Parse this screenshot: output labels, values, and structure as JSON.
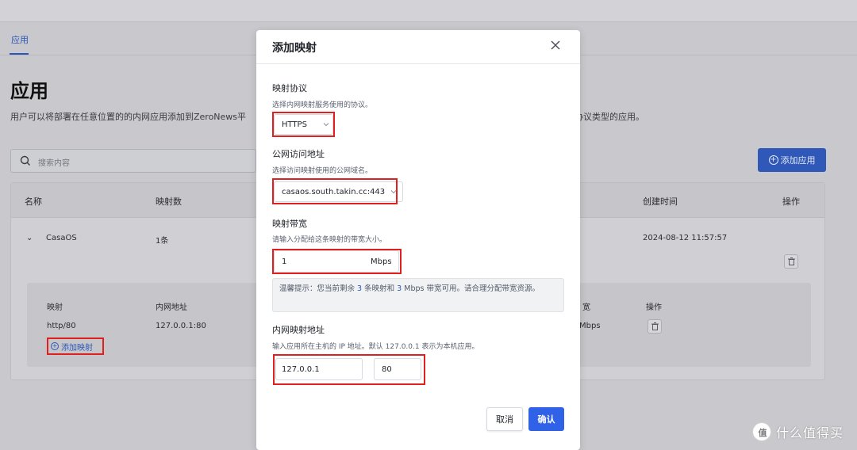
{
  "background": {
    "nav_tab": "应用",
    "title": "应用",
    "description_left": "用户可以将部署在任意位置的的内网应用添加到ZeroNews平",
    "description_right": "协议类型的应用。",
    "search_placeholder": "搜索内容",
    "add_app_button": "添加应用",
    "table": {
      "headers": {
        "name": "名称",
        "mappings": "映射数",
        "created": "创建时间",
        "actions": "操作"
      },
      "row": {
        "name": "CasaOS",
        "mapping_count": "1条",
        "created": "2024-08-12 11:57:57"
      },
      "sub_headers": {
        "mapping": "映射",
        "internal": "内网地址",
        "bandwidth_tail": "宽",
        "actions": "操作"
      },
      "sub_row": {
        "mapping": "http/80",
        "internal": "127.0.0.1:80",
        "bandwidth_tail": "Mbps"
      },
      "add_mapping": "添加映射"
    }
  },
  "modal": {
    "title": "添加映射",
    "protocol": {
      "label": "映射协议",
      "hint": "选择内网映射服务使用的协议。",
      "value": "HTTPS"
    },
    "public_address": {
      "label": "公网访问地址",
      "hint": "选择访问映射使用的公网域名。",
      "value": "casaos.south.takin.cc:443"
    },
    "bandwidth": {
      "label": "映射带宽",
      "hint": "请输入分配给这条映射的带宽大小。",
      "value": "1",
      "unit": "Mbps"
    },
    "notice": {
      "prefix": "温馨提示：您当前剩余",
      "mappings_left": "3",
      "middle": "条映射和",
      "bandwidth_left": "3",
      "suffix": "Mbps 带宽可用。请合理分配带宽资源。"
    },
    "internal_address": {
      "label": "内网映射地址",
      "hint": "输入应用所在主机的 IP 地址。默认 127.0.0.1 表示为本机应用。",
      "ip": "127.0.0.1",
      "port": "80"
    },
    "cancel": "取消",
    "confirm": "确认"
  },
  "watermark": "什么值得买",
  "watermark_logo": "值",
  "colors": {
    "primary": "#2f62e6",
    "highlight_box": "#e0201e"
  }
}
